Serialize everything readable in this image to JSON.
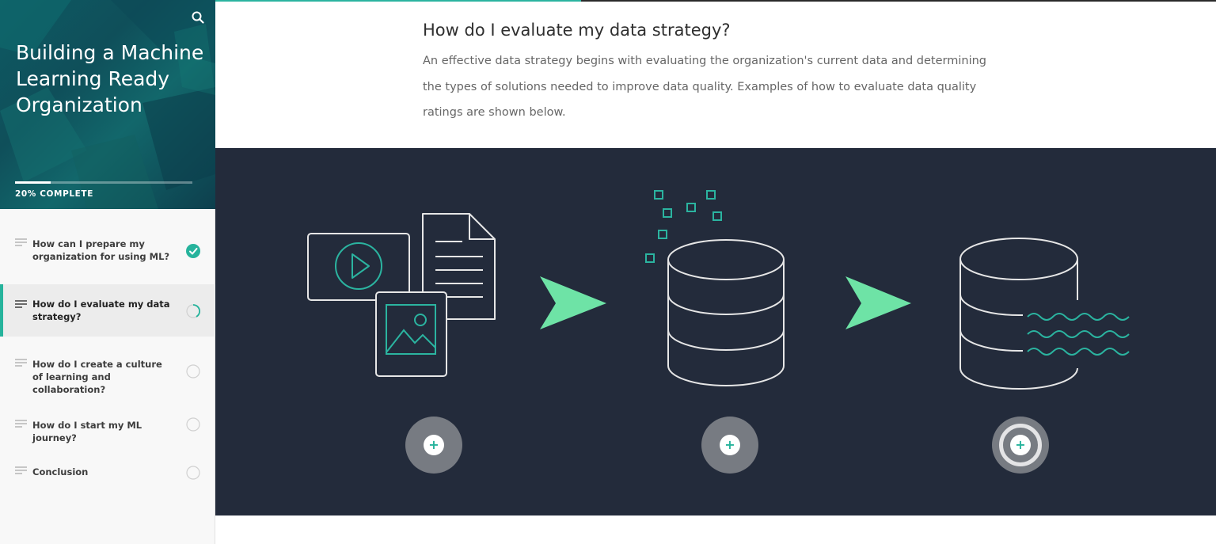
{
  "sidebar": {
    "course_title": "Building a Machine Learning Ready Organization",
    "progress_label": "20% COMPLETE",
    "progress_fraction": 0.2,
    "search_icon": "search-icon",
    "items": [
      {
        "label": "How can I prepare my organization for using ML?",
        "status": "complete",
        "icon": "check-circle-icon"
      },
      {
        "label": "How do I evaluate my data strategy?",
        "status": "in-progress",
        "icon": "partial-circle-icon",
        "active": true
      },
      {
        "label": "How do I create a culture of learning and collaboration?",
        "status": "not-started",
        "icon": "empty-circle-icon"
      },
      {
        "label": "How do I start my ML journey?",
        "status": "not-started",
        "icon": "empty-circle-icon"
      },
      {
        "label": "Conclusion",
        "status": "not-started",
        "icon": "empty-circle-icon"
      }
    ]
  },
  "main": {
    "title": "How do I evaluate my data strategy?",
    "body": "An effective data strategy begins with evaluating the organization's current data and determining the types of solutions needed to improve data quality. Examples of how to evaluate data quality ratings are shown below.",
    "hotspots": [
      {
        "symbol": "+",
        "icon": "plus-icon"
      },
      {
        "symbol": "+",
        "icon": "plus-icon"
      },
      {
        "symbol": "+",
        "icon": "plus-icon"
      }
    ]
  },
  "colors": {
    "accent": "#26b39c",
    "arrow": "#6ee3a6",
    "panel": "#232b3b",
    "sidebar_header": "#0f5560"
  }
}
